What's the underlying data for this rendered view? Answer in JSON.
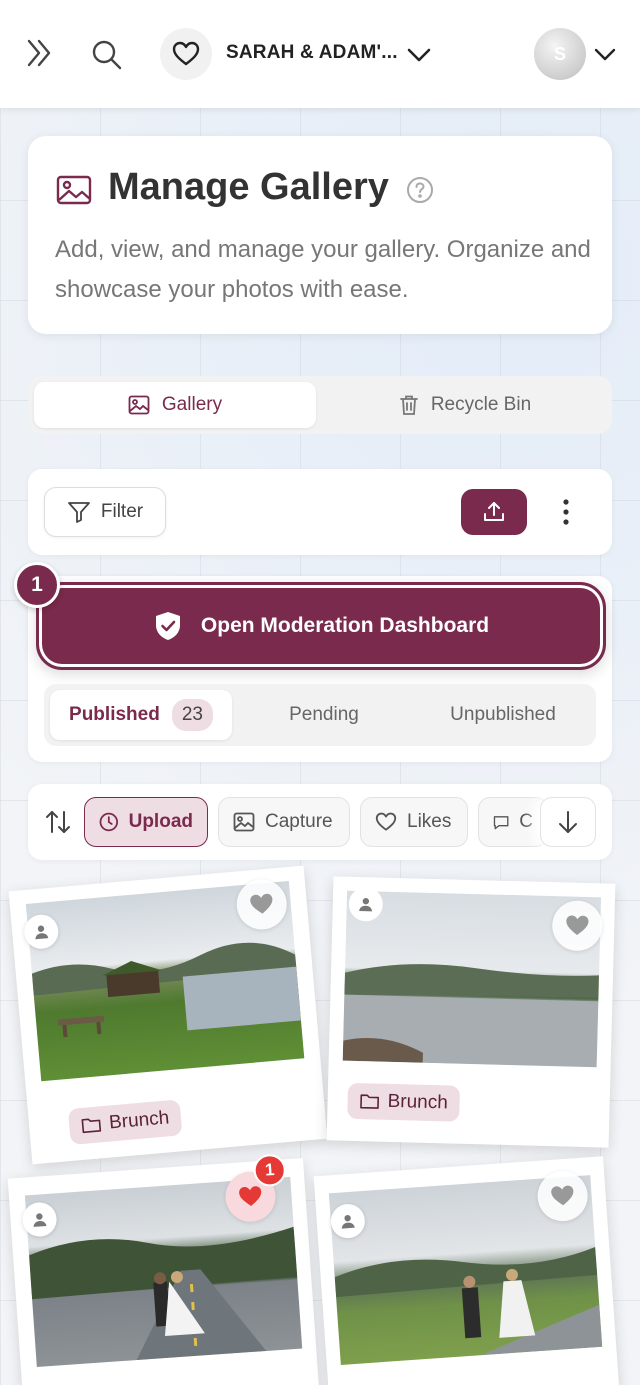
{
  "topbar": {
    "event_name": "SARAH & ADAM'...",
    "avatar_initial": "S"
  },
  "header": {
    "title": "Manage Gallery",
    "description": "Add, view, and manage your gallery. Organize and showcase your photos with ease."
  },
  "tabs": [
    {
      "label": "Gallery",
      "icon": "image-icon",
      "active": true
    },
    {
      "label": "Recycle Bin",
      "icon": "trash-icon",
      "active": false
    }
  ],
  "toolbar": {
    "filter_label": "Filter",
    "upload_icon": "upload-icon",
    "more_icon": "more-vertical-icon"
  },
  "moderation": {
    "badge": "1",
    "button_label": "Open Moderation Dashboard",
    "status_tabs": [
      {
        "label": "Published",
        "count": "23",
        "active": true
      },
      {
        "label": "Pending"
      },
      {
        "label": "Unpublished"
      }
    ]
  },
  "sort": {
    "chips": [
      {
        "label": "Upload",
        "icon": "clock-icon",
        "active": true
      },
      {
        "label": "Capture",
        "icon": "image-icon"
      },
      {
        "label": "Likes",
        "icon": "heart-icon"
      },
      {
        "label": "C",
        "icon": "comment-icon"
      }
    ],
    "direction_icon": "arrow-down-icon"
  },
  "photos": [
    {
      "tag": "Brunch",
      "likes": null,
      "liked": false
    },
    {
      "tag": "Brunch",
      "likes": null,
      "liked": false
    },
    {
      "tag": "",
      "likes": "1",
      "liked": true
    },
    {
      "tag": "",
      "likes": null,
      "liked": false
    }
  ],
  "colors": {
    "accent": "#7a2a4c",
    "accent_light": "#efdde4",
    "like_red": "#e53935"
  }
}
